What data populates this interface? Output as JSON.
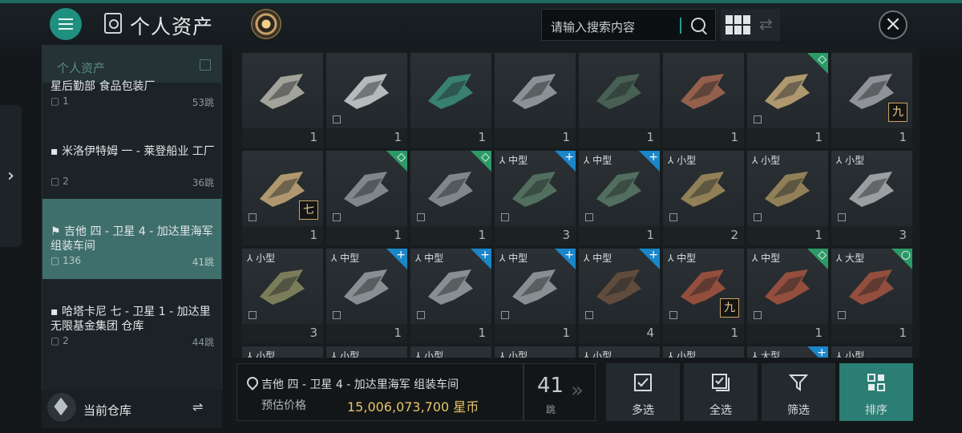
{
  "header": {
    "title": "个人资产",
    "search_placeholder": "请输入搜索内容"
  },
  "panel": {
    "header_title": "个人资产",
    "locations": [
      {
        "name": "星后勤部 食品包装厂",
        "count": "1",
        "jumps": "53跳"
      },
      {
        "name": "米洛伊特姆 一 - 莱登船业 工厂",
        "count": "2",
        "jumps": "36跳"
      },
      {
        "name": "吉他 四 - 卫星 4 - 加达里海军 组装车间",
        "count": "136",
        "jumps": "41跳"
      },
      {
        "name": "哈塔卡尼 七 - 卫星 1 - 加达里无限基金集团 仓库",
        "count": "2",
        "jumps": "44跳"
      }
    ],
    "current_warehouse": "当前仓库"
  },
  "grid": {
    "items": [
      {
        "qty": "1",
        "tag": "",
        "corner": "",
        "level": "",
        "art": "ship-a"
      },
      {
        "qty": "1",
        "tag": "",
        "corner": "",
        "level": "",
        "art": "ship-b"
      },
      {
        "qty": "1",
        "tag": "",
        "corner": "",
        "level": "",
        "art": "ship-c"
      },
      {
        "qty": "1",
        "tag": "",
        "corner": "",
        "level": "",
        "art": "ship-d"
      },
      {
        "qty": "1",
        "tag": "",
        "corner": "",
        "level": "",
        "art": "ship-e"
      },
      {
        "qty": "1",
        "tag": "",
        "corner": "",
        "level": "",
        "art": "ship-f"
      },
      {
        "qty": "1",
        "tag": "",
        "corner": "◇",
        "level": "",
        "art": "ship-g"
      },
      {
        "qty": "1",
        "tag": "",
        "corner": "",
        "level": "九",
        "art": "ship-h"
      },
      {
        "qty": "1",
        "tag": "",
        "corner": "",
        "level": "七",
        "art": "ship-g"
      },
      {
        "qty": "1",
        "tag": "",
        "corner": "◇",
        "level": "",
        "art": "ship-i"
      },
      {
        "qty": "1",
        "tag": "",
        "corner": "◇",
        "level": "",
        "art": "ship-i"
      },
      {
        "qty": "3",
        "tag": "中型",
        "corner": "+",
        "level": "",
        "art": "mod-a"
      },
      {
        "qty": "1",
        "tag": "中型",
        "corner": "+",
        "level": "",
        "art": "mod-a"
      },
      {
        "qty": "2",
        "tag": "小型",
        "corner": "",
        "level": "",
        "art": "mod-b"
      },
      {
        "qty": "1",
        "tag": "小型",
        "corner": "",
        "level": "",
        "art": "mod-b"
      },
      {
        "qty": "3",
        "tag": "小型",
        "corner": "",
        "level": "",
        "art": "mod-c"
      },
      {
        "qty": "3",
        "tag": "小型",
        "corner": "",
        "level": "",
        "art": "mod-d"
      },
      {
        "qty": "1",
        "tag": "中型",
        "corner": "+",
        "level": "",
        "art": "mod-e"
      },
      {
        "qty": "1",
        "tag": "中型",
        "corner": "+",
        "level": "",
        "art": "mod-e"
      },
      {
        "qty": "1",
        "tag": "中型",
        "corner": "+",
        "level": "",
        "art": "mod-e"
      },
      {
        "qty": "4",
        "tag": "中型",
        "corner": "+",
        "level": "",
        "art": "mod-f"
      },
      {
        "qty": "1",
        "tag": "中型",
        "corner": "",
        "level": "九",
        "art": "ammo"
      },
      {
        "qty": "1",
        "tag": "中型",
        "corner": "◇",
        "level": "",
        "art": "ammo"
      },
      {
        "qty": "1",
        "tag": "大型",
        "corner": "○",
        "level": "",
        "art": "ammo"
      },
      {
        "qty": "",
        "tag": "小型",
        "corner": "",
        "level": "",
        "art": ""
      },
      {
        "qty": "",
        "tag": "小型",
        "corner": "",
        "level": "",
        "art": ""
      },
      {
        "qty": "",
        "tag": "小型",
        "corner": "",
        "level": "",
        "art": ""
      },
      {
        "qty": "",
        "tag": "小型",
        "corner": "",
        "level": "",
        "art": ""
      },
      {
        "qty": "",
        "tag": "小型",
        "corner": "",
        "level": "",
        "art": ""
      },
      {
        "qty": "",
        "tag": "小型",
        "corner": "",
        "level": "",
        "art": ""
      },
      {
        "qty": "",
        "tag": "大型",
        "corner": "+",
        "level": "",
        "art": ""
      },
      {
        "qty": "",
        "tag": "小型",
        "corner": "",
        "level": "",
        "art": ""
      }
    ]
  },
  "footer": {
    "location": "吉他 四 - 卫星 4 - 加达里海军 组装车间",
    "price_label": "预估价格",
    "price_value": "15,006,073,700 星币",
    "jumps_number": "41",
    "jumps_unit": "跳",
    "buttons": {
      "multi": "多选",
      "all": "全选",
      "filter": "筛选",
      "sort": "排序"
    }
  },
  "colors": {
    "accent": "#1f8f80",
    "price": "#e7c46a",
    "plus_badge": "#1b86c8",
    "diamond_badge": "#2c9a66"
  }
}
